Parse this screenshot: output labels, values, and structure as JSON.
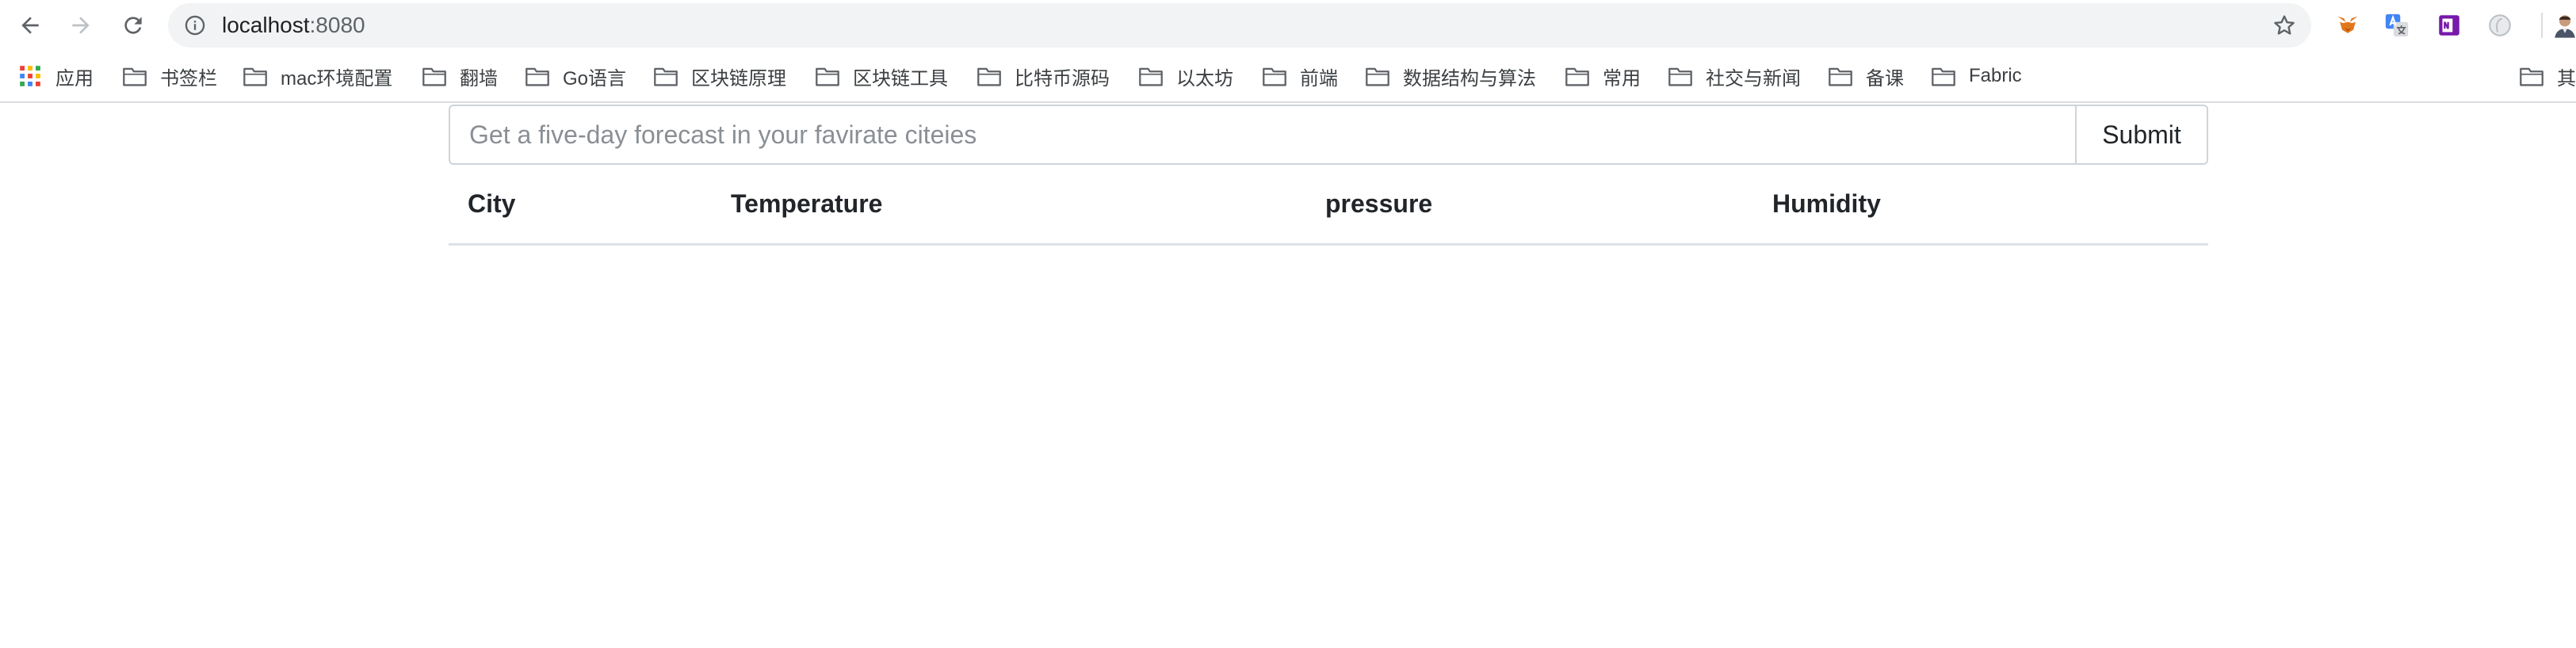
{
  "browser": {
    "url_host": "localhost",
    "url_port": ":8080",
    "extensions": [
      "metamask-icon",
      "google-translate-icon",
      "onenote-icon",
      "extension-disabled-icon",
      "profile-avatar"
    ]
  },
  "bookmarks": {
    "apps_label": "应用",
    "items": [
      {
        "label": "书签栏"
      },
      {
        "label": "mac环境配置"
      },
      {
        "label": "翻墙"
      },
      {
        "label": "Go语言"
      },
      {
        "label": "区块链原理"
      },
      {
        "label": "区块链工具"
      },
      {
        "label": "比特币源码"
      },
      {
        "label": "以太坊"
      },
      {
        "label": "前端"
      },
      {
        "label": "数据结构与算法"
      },
      {
        "label": "常用"
      },
      {
        "label": "社交与新闻"
      },
      {
        "label": "备课"
      },
      {
        "label": "Fabric"
      }
    ],
    "overflow_label": "其"
  },
  "form": {
    "placeholder": "Get a five-day forecast in your favirate citeies",
    "value": "",
    "submit_label": "Submit"
  },
  "table": {
    "headers": [
      "City",
      "Temperature",
      "pressure",
      "Humidity"
    ],
    "rows": []
  },
  "colors": {
    "omnibox_bg": "#f1f3f4",
    "border": "#ced4da",
    "table_rule": "#dee2e6"
  }
}
